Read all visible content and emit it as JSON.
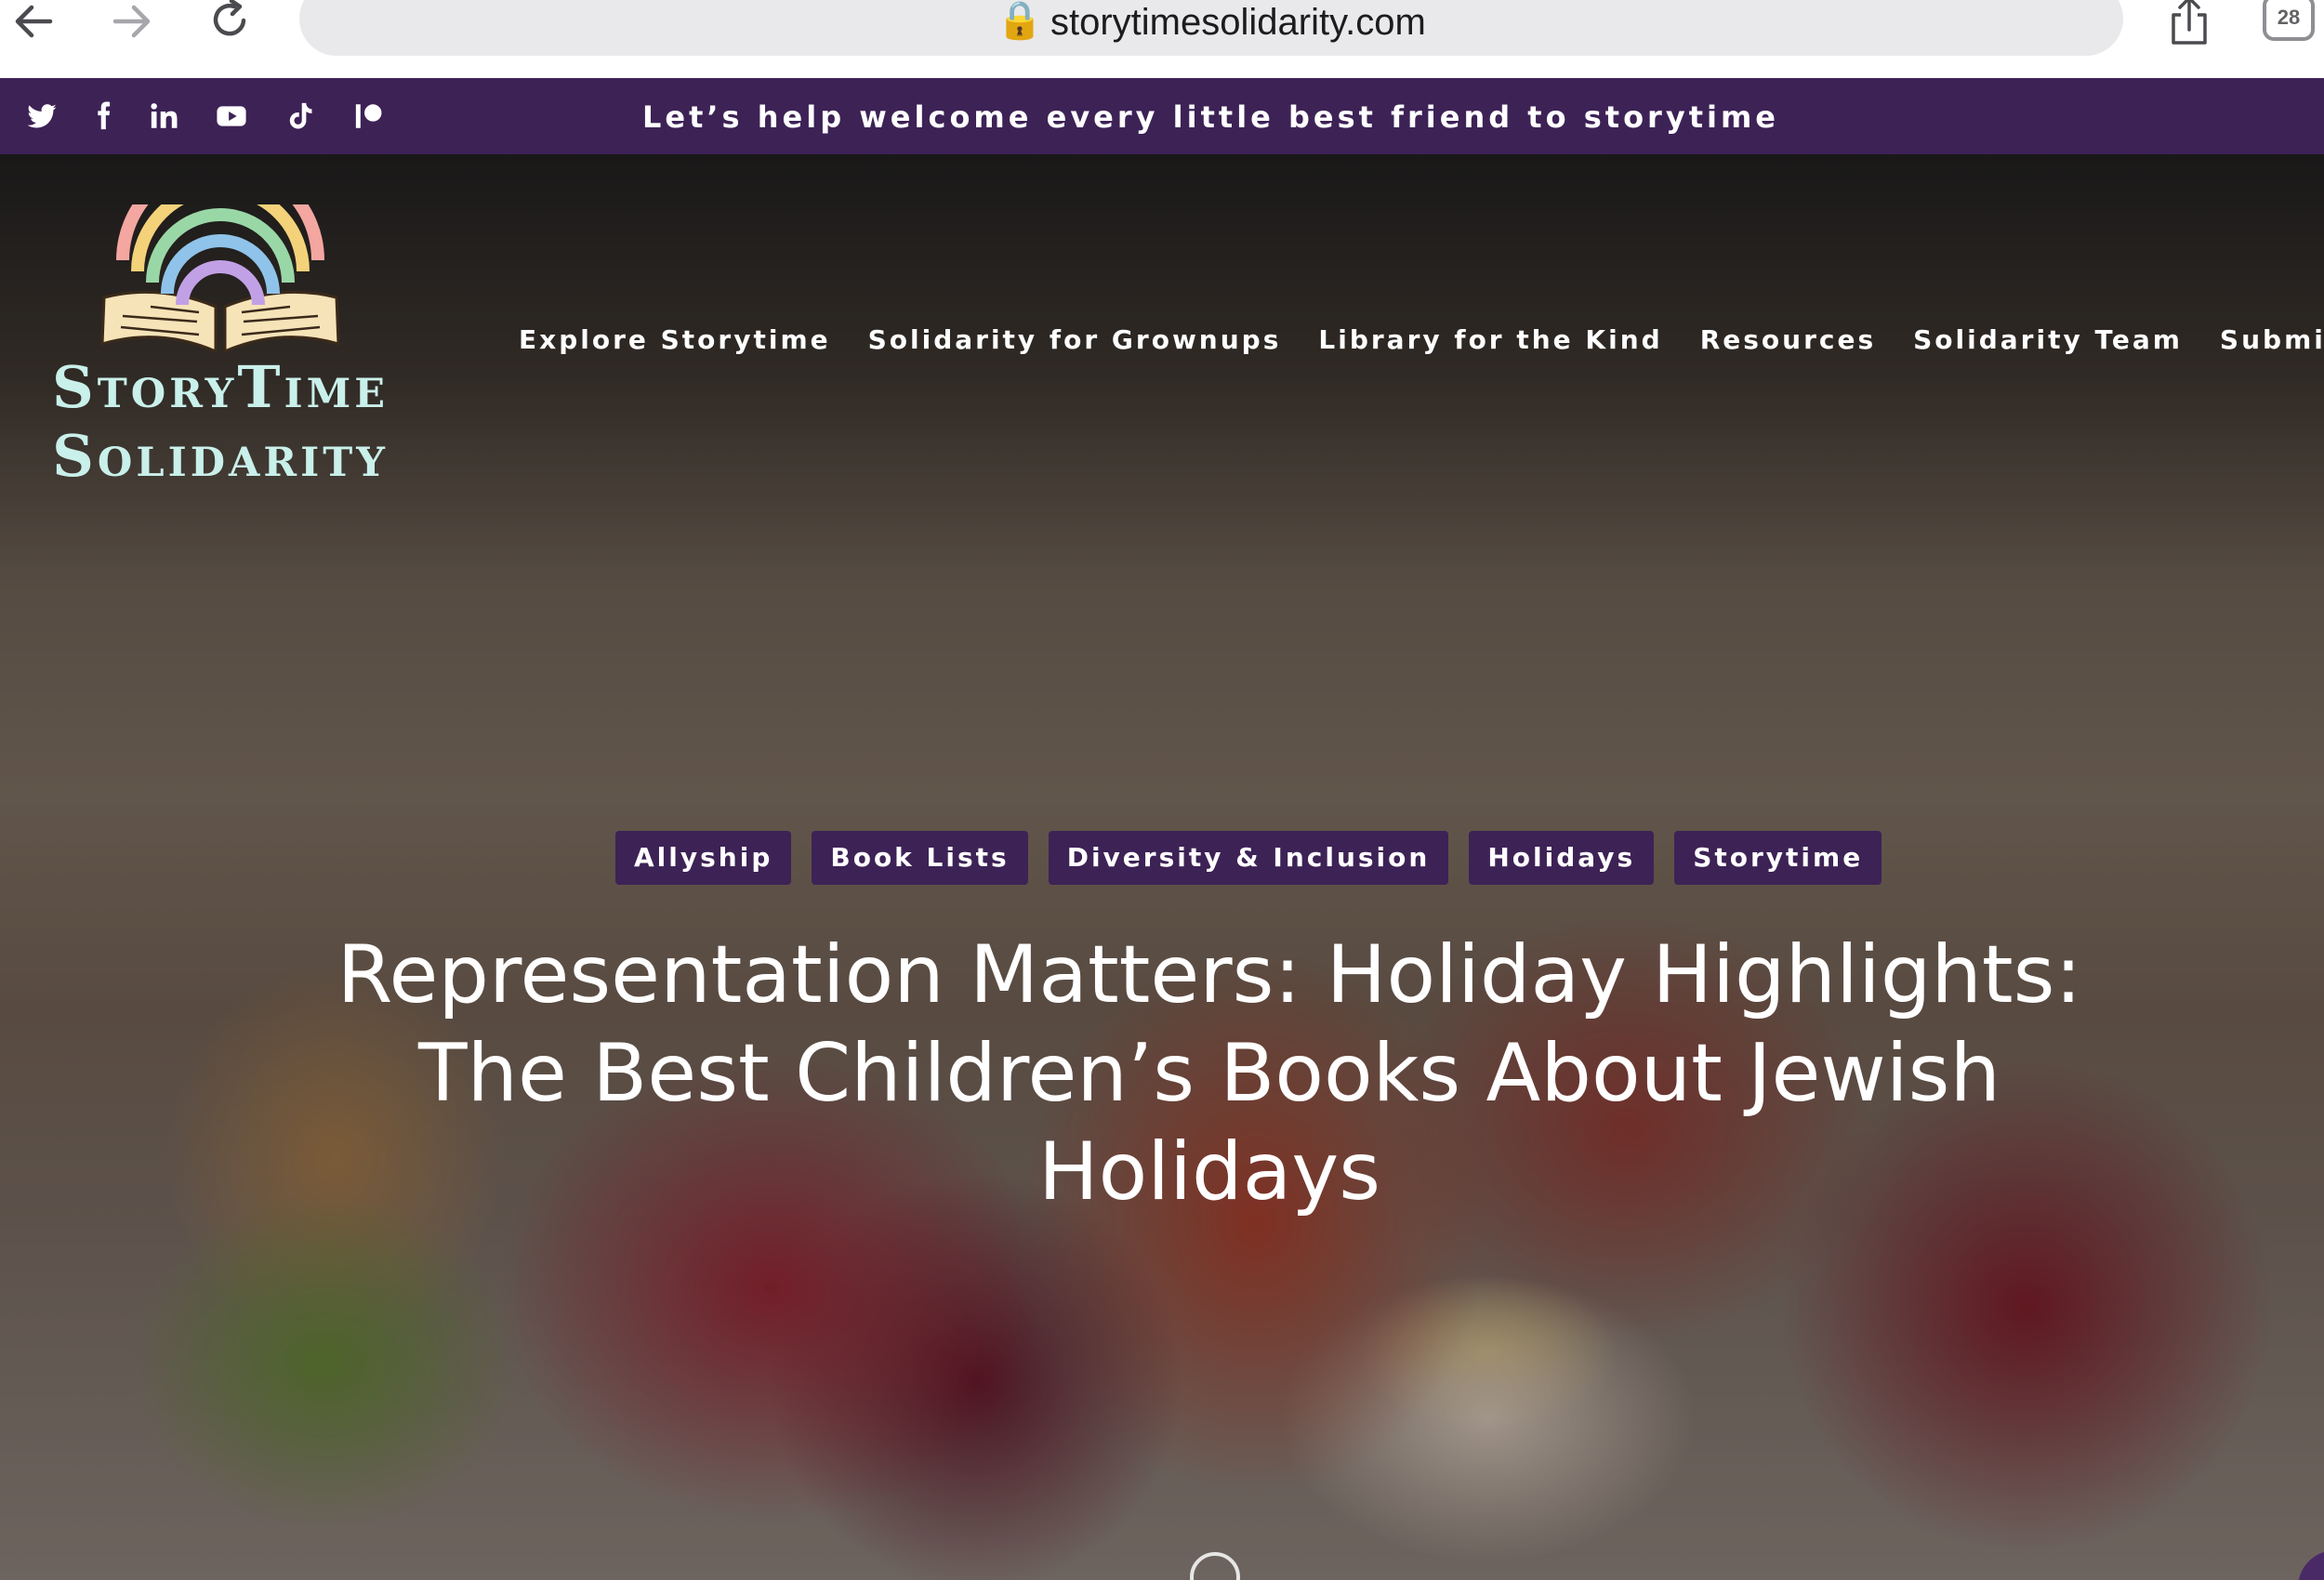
{
  "browser": {
    "url": "storytimesolidarity.com",
    "lock_glyph": "🔒",
    "tab_count": "28",
    "icons": [
      "back-arrow-icon",
      "forward-arrow-icon",
      "reload-icon",
      "lock-icon",
      "microphone-icon",
      "share-icon",
      "tabs-icon"
    ]
  },
  "top_strip": {
    "tagline": "Let’s help welcome every little best friend to storytime",
    "social_icons": [
      "twitter-icon",
      "facebook-icon",
      "linkedin-icon",
      "youtube-icon",
      "tiktok-icon",
      "patreon-icon"
    ],
    "background_color": "#3d2256"
  },
  "logo": {
    "line1": "StoryTime",
    "line2": "Solidarity",
    "color": "#c9f0ea"
  },
  "nav": {
    "items": [
      "Explore Storytime",
      "Solidarity for Grownups",
      "Library for the Kind",
      "Resources",
      "Solidarity Team",
      "Submissions"
    ]
  },
  "post": {
    "tags": [
      "Allyship",
      "Book Lists",
      "Diversity & Inclusion",
      "Holidays",
      "Storytime"
    ],
    "title": "Representation Matters: Holiday Highlights: The Best Children’s Books About Jewish Holidays"
  },
  "colors": {
    "accent_purple": "#3d2256",
    "text_light": "#ffffff"
  }
}
